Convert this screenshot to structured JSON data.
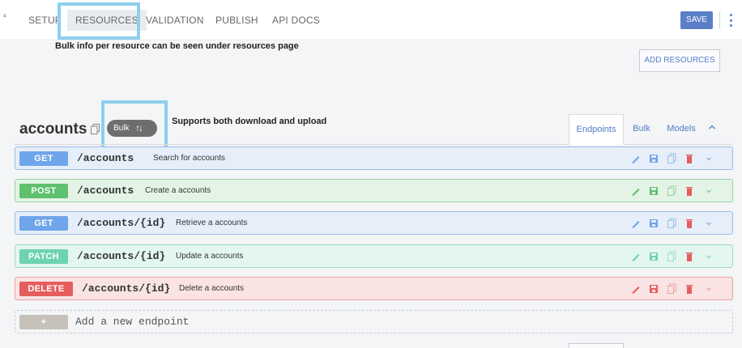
{
  "nav": {
    "tabs": [
      {
        "label": "SETUP"
      },
      {
        "label": "RESOURCES",
        "active": true
      },
      {
        "label": "VALIDATION"
      },
      {
        "label": "PUBLISH"
      },
      {
        "label": "API DOCS"
      }
    ],
    "save_label": "SAVE"
  },
  "annotations": {
    "resources_note": "Bulk info per resource can be seen under resources page",
    "bulk_note": "Supports both download and upload"
  },
  "add_resources_label": "ADD RESOURCES",
  "resource": {
    "name": "accounts",
    "bulk_label": "Bulk",
    "tabs": [
      {
        "label": "Endpoints",
        "active": true
      },
      {
        "label": "Bulk"
      },
      {
        "label": "Models"
      }
    ]
  },
  "endpoints": [
    {
      "method": "GET",
      "path": "/accounts",
      "description": "Search for accounts"
    },
    {
      "method": "POST",
      "path": "/accounts",
      "description": "Create a accounts"
    },
    {
      "method": "GET",
      "path": "/accounts/{id}",
      "description": "Retrieve a accounts"
    },
    {
      "method": "PATCH",
      "path": "/accounts/{id}",
      "description": "Update a accounts"
    },
    {
      "method": "DELETE",
      "path": "/accounts/{id}",
      "description": "Delete a accounts"
    }
  ],
  "new_endpoint": {
    "button": "+",
    "label": "Add a new endpoint"
  },
  "colors": {
    "accent": "#5b7fc6",
    "highlight": "#8dd0ee",
    "get": "#6fa5ea",
    "post": "#5fc06d",
    "patch": "#6dd3b1",
    "delete": "#e55d5d"
  },
  "icons": [
    "edit-icon",
    "save-icon",
    "copy-icon",
    "delete-icon",
    "chevron-down-icon"
  ]
}
